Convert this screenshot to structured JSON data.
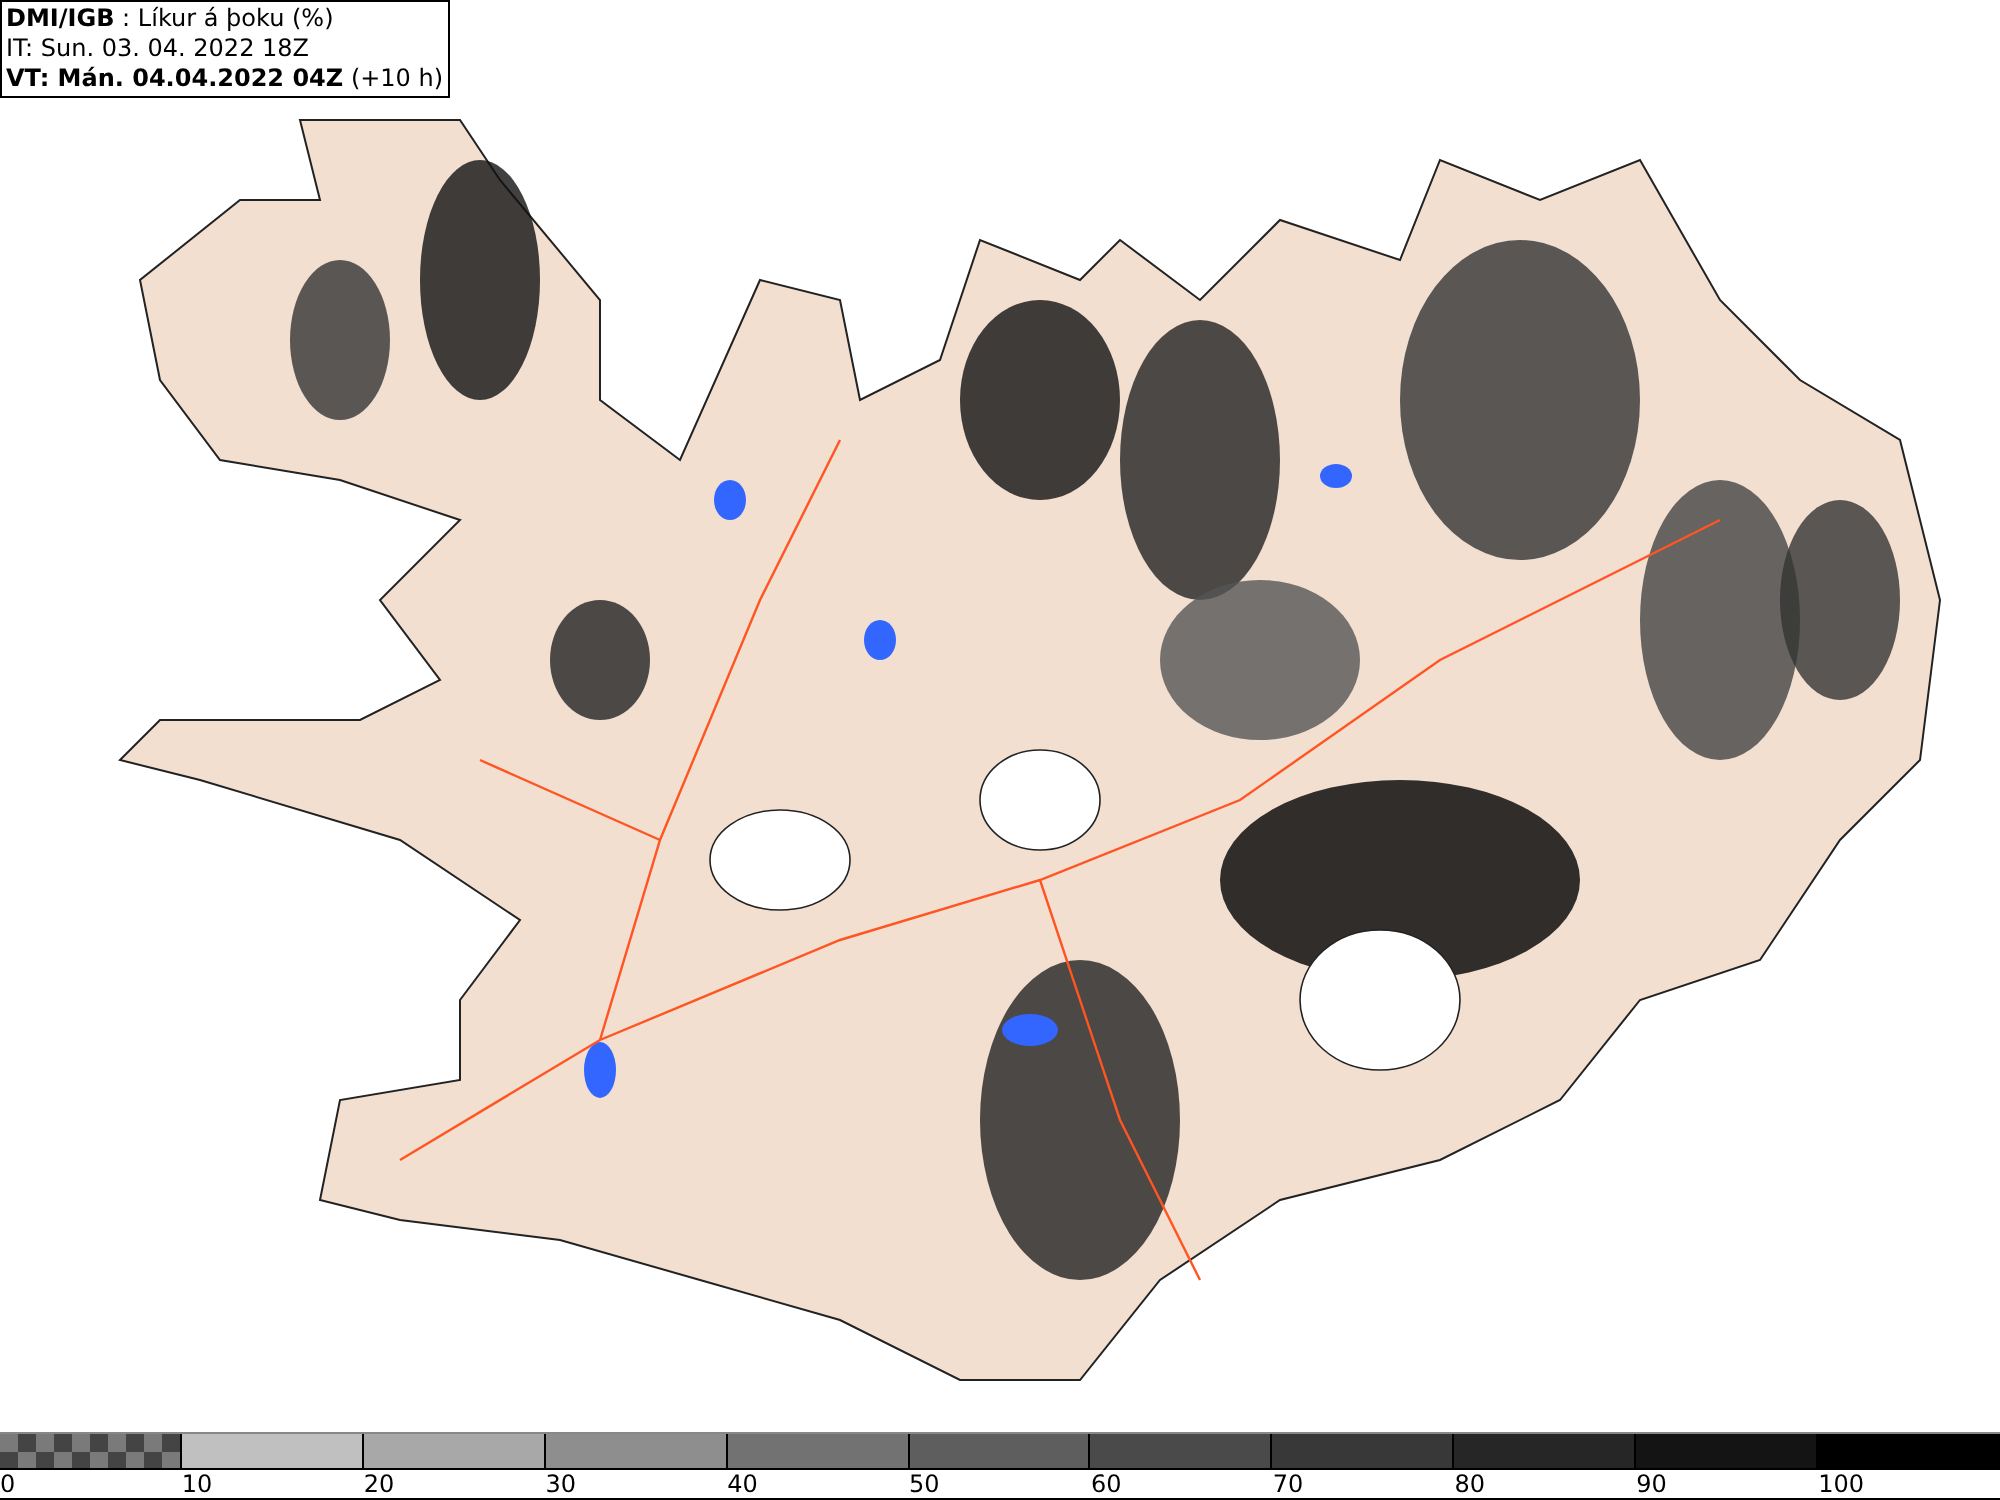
{
  "header": {
    "source": "DMI/IGB",
    "separator": ":",
    "title": "Líkur á þoku (%)",
    "issue_time": "IT: Sun. 03. 04. 2022 18Z",
    "valid_time": "VT: Mán. 04.04.2022 04Z",
    "valid_offset": "(+10 h)"
  },
  "legend": {
    "segments": [
      {
        "kind": "checker",
        "color": "#7a7a7a"
      },
      {
        "kind": "solid",
        "color": "#c0c0c0"
      },
      {
        "kind": "solid",
        "color": "#a8a8a8"
      },
      {
        "kind": "solid",
        "color": "#8e8e8e"
      },
      {
        "kind": "solid",
        "color": "#727272"
      },
      {
        "kind": "solid",
        "color": "#5e5e5e"
      },
      {
        "kind": "solid",
        "color": "#4a4a4a"
      },
      {
        "kind": "solid",
        "color": "#383838"
      },
      {
        "kind": "solid",
        "color": "#262626"
      },
      {
        "kind": "solid",
        "color": "#141414"
      },
      {
        "kind": "solid",
        "color": "#000000"
      }
    ],
    "labels": [
      "0",
      "10",
      "20",
      "30",
      "40",
      "50",
      "60",
      "70",
      "80",
      "90",
      "100"
    ]
  }
}
